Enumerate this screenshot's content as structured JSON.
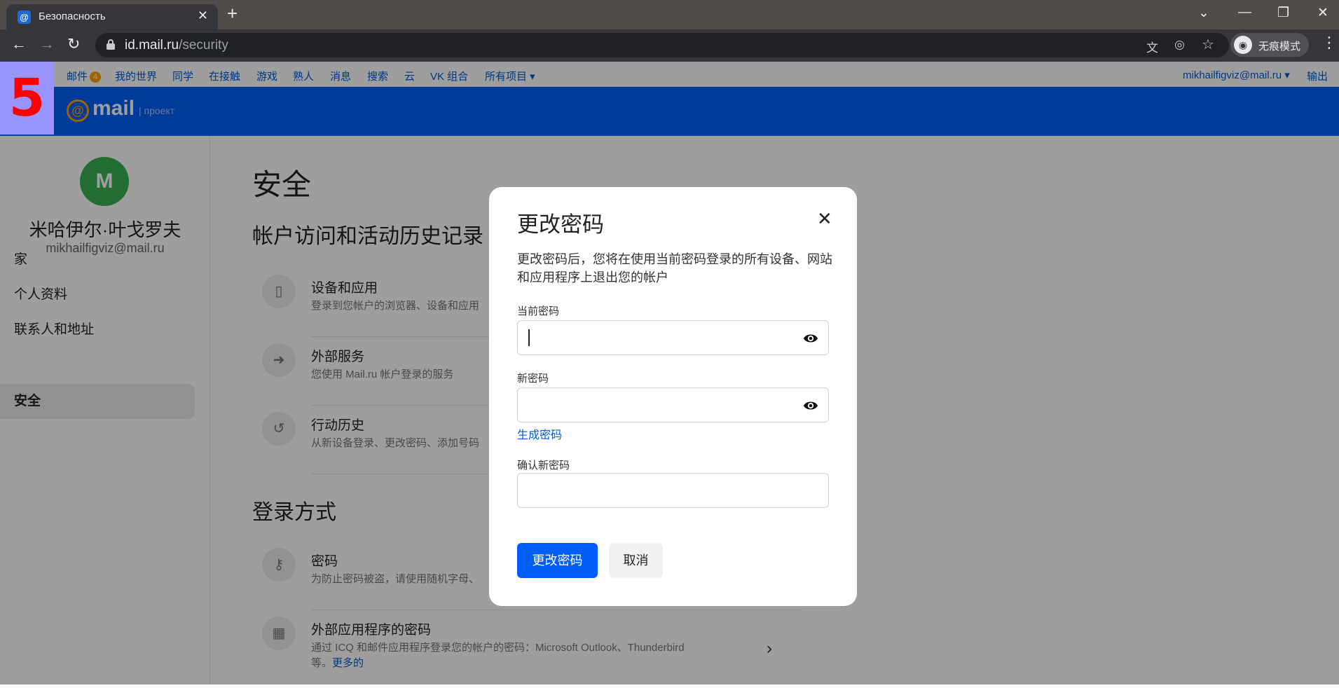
{
  "browser": {
    "tab_title": "Безопасность",
    "tab_favicon": "@",
    "url_host": "id.mail.ru",
    "url_path": "/security",
    "incognito_label": "无痕模式"
  },
  "portal": {
    "links": [
      "邮件",
      "我的世界",
      "同学",
      "在接触",
      "游戏",
      "熟人",
      "消息",
      "搜索",
      "云",
      "VK 组合",
      "所有项目 ▾"
    ],
    "mail_badge": "4",
    "account": "mikhailfigviz@mail.ru ▾",
    "logout": "输出"
  },
  "overlay_badge": "5",
  "brand": {
    "at": "@",
    "name": "mail",
    "project": "| проект"
  },
  "sidebar": {
    "avatar_letter": "M",
    "name": "米哈伊尔·叶戈罗夫",
    "email": "mikhailfigviz@mail.ru",
    "items": [
      {
        "label": "家"
      },
      {
        "label": "个人资料"
      },
      {
        "label": "联系人和地址"
      },
      {
        "label": "安全"
      }
    ]
  },
  "main": {
    "title": "安全",
    "section1": "帐户访问和活动历史记录",
    "rows1": [
      {
        "title": "设备和应用",
        "desc": "登录到您帐户的浏览器、设备和应用"
      },
      {
        "title": "外部服务",
        "desc": "您使用 Mail.ru 帐户登录的服务"
      },
      {
        "title": "行动历史",
        "desc": "从新设备登录、更改密码、添加号码"
      }
    ],
    "section2": "登录方式",
    "rows2": [
      {
        "title": "密码",
        "desc": "为防止密码被盗，请使用随机字母、"
      },
      {
        "title": "外部应用程序的密码",
        "desc": "通过 ICQ 和邮件应用程序登录您的帐户的密码：Microsoft Outlook、Thunderbird",
        "desc2": "等。",
        "more": "更多的"
      }
    ]
  },
  "modal": {
    "title": "更改密码",
    "description": "更改密码后，您将在使用当前密码登录的所有设备、网站和应用程序上退出您的帐户",
    "current_label": "当前密码",
    "current_value": "",
    "new_label": "新密码",
    "new_value": "",
    "generate_link": "生成密码",
    "confirm_label": "确认新密码",
    "confirm_value": "",
    "submit": "更改密码",
    "cancel": "取消"
  },
  "colors": {
    "brand_blue": "#005ff9",
    "link": "#005bd1",
    "avatar_green": "#3bb151",
    "badge_orange": "#ff9e00"
  }
}
